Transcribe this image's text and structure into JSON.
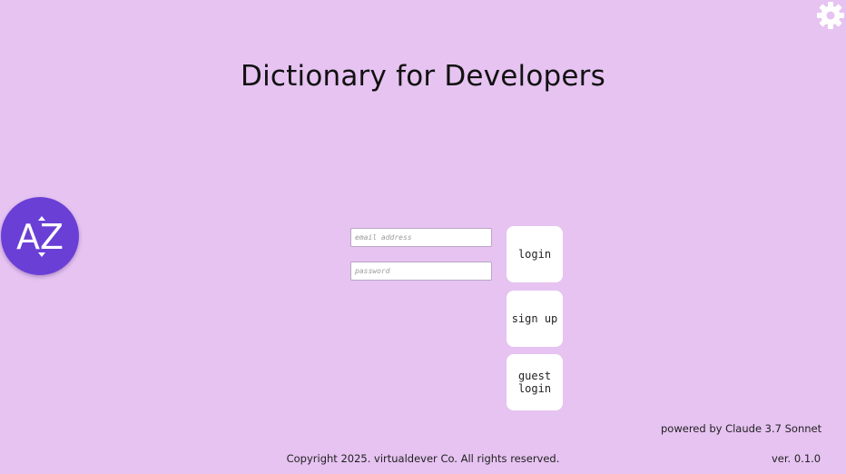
{
  "app": {
    "title": "Dictionary for Developers",
    "logo_text": "AZ"
  },
  "icons": {
    "settings": "gear-icon",
    "logo": "az-sort-icon"
  },
  "colors": {
    "background": "#e6c3f1",
    "logo_background": "#6a3fd6",
    "button_background": "#ffffff"
  },
  "login_form": {
    "email_placeholder": "email address",
    "email_value": "",
    "password_placeholder": "password",
    "password_value": "",
    "login_label": "login",
    "signup_label": "sign up",
    "guest_label": "guest\nlogin"
  },
  "footer": {
    "powered_by": "powered by Claude 3.7 Sonnet",
    "copyright": "Copyright 2025. virtualdever Co. All rights reserved.",
    "version": "ver. 0.1.0"
  }
}
